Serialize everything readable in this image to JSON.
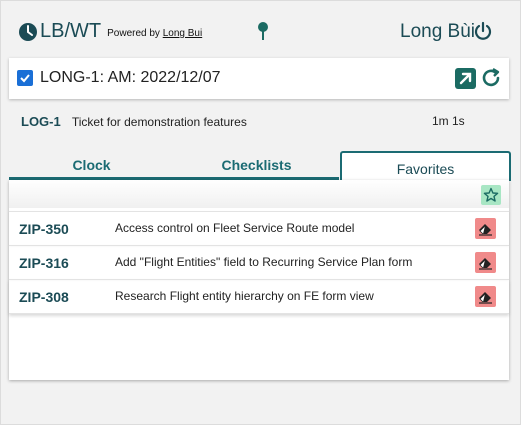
{
  "header": {
    "app_name": "LB/WT",
    "powered_prefix": "Powered by",
    "powered_link": "Long Bui",
    "user_name": "Long Bùi"
  },
  "active_ticket": {
    "checked": true,
    "label": "LONG-1: AM: 2022/12/07"
  },
  "log": {
    "id": "LOG-1",
    "description": "Ticket for demonstration features",
    "duration": "1m 1s"
  },
  "tabs": [
    {
      "label": "Clock"
    },
    {
      "label": "Checklists"
    },
    {
      "label": "Favorites",
      "active": true
    }
  ],
  "favorites": [
    {
      "id": "ZIP-350",
      "title": "Access control on Fleet Service Route model"
    },
    {
      "id": "ZIP-316",
      "title": "Add \"Flight Entities\" field to Recurring Service Plan form"
    },
    {
      "id": "ZIP-308",
      "title": "Research Flight entity hierarchy on FE form view"
    }
  ],
  "colors": {
    "primary": "#1b4b55",
    "teal": "#1b6b73",
    "accent_green": "#a8e6c4",
    "danger": "#f08a8a",
    "checkbox": "#1a6fd6"
  },
  "icons": {
    "logo": "clock-icon",
    "pin": "pin-icon",
    "logout": "power-icon",
    "open": "open-external-icon",
    "refresh": "refresh-icon",
    "add_favorite": "star-icon",
    "remove": "eraser-icon"
  }
}
